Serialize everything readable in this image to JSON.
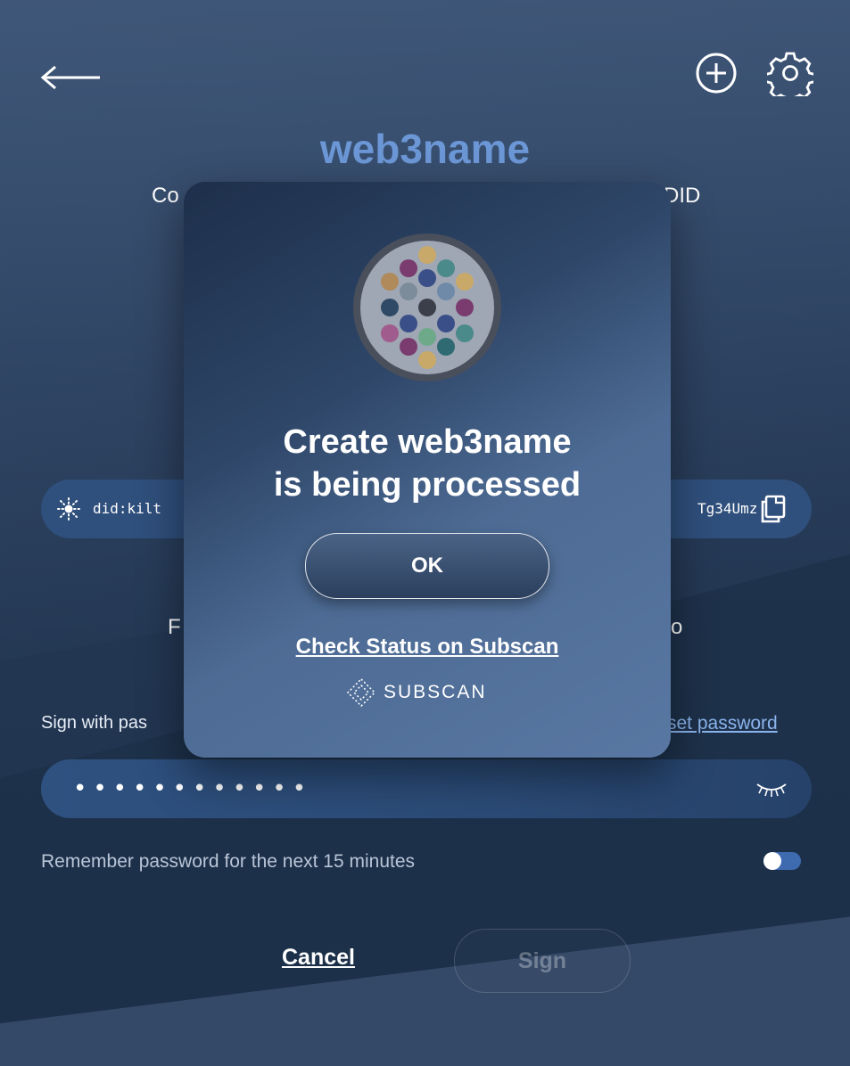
{
  "header": {
    "title": "web3name",
    "back_icon": "arrow-left-icon",
    "add_icon": "plus-circle-icon",
    "settings_icon": "gear-icon"
  },
  "background_text": {
    "left_fragment": "Co",
    "right_fragment": "DID",
    "features_left": "F",
    "features_right": "o"
  },
  "did": {
    "prefix": "did:kilt",
    "suffix": "Tg34Umz",
    "icon": "kilt-sun-icon",
    "copy_icon": "copy-icon"
  },
  "password": {
    "label": "Sign with pas",
    "reset_link": "set password",
    "masked_value": "••••••••••••",
    "eye_icon": "eye-closed-icon"
  },
  "remember": {
    "label": "Remember password for the next 15 minutes",
    "enabled": true
  },
  "actions": {
    "cancel": "Cancel",
    "sign": "Sign"
  },
  "modal": {
    "title_line1": "Create web3name",
    "title_line2": "is being processed",
    "ok": "OK",
    "status_link": "Check Status on Subscan",
    "subscan_logo": "SUBSCAN"
  },
  "colors": {
    "title": "#6c97d6",
    "link": "#8bb4ee",
    "toggle": "#3e6bb0"
  }
}
